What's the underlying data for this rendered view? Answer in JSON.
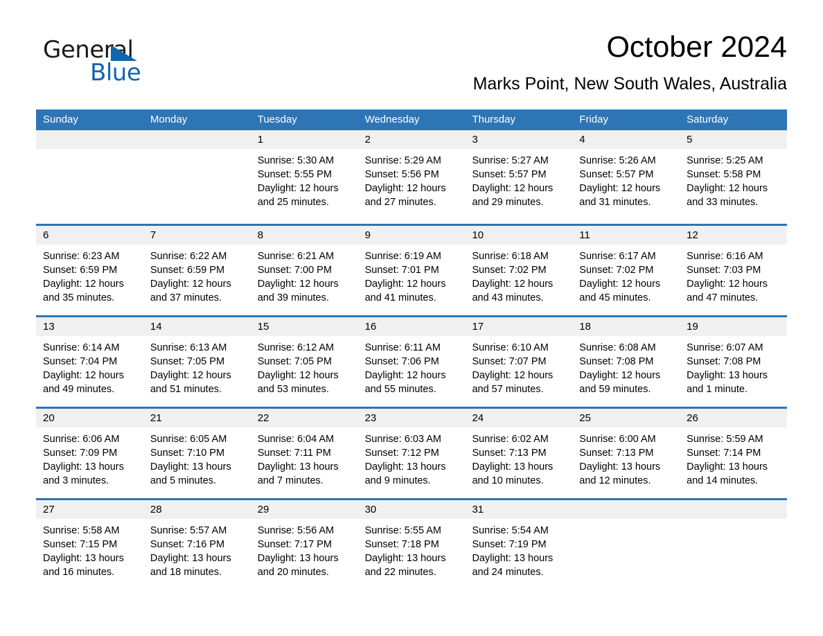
{
  "logo": {
    "word_one": "General",
    "word_two": "Blue",
    "triangle_icon": "triangle-icon",
    "brand_color": "#1266AC"
  },
  "header": {
    "title": "October 2024",
    "subtitle": "Marks Point, New South Wales, Australia"
  },
  "theme": {
    "header_blue": "#2E75B6",
    "day_band_gray": "#F0F0F0",
    "text_black": "#000000",
    "header_text": "#FFFFFF"
  },
  "weekdays": [
    "Sunday",
    "Monday",
    "Tuesday",
    "Wednesday",
    "Thursday",
    "Friday",
    "Saturday"
  ],
  "weeks": [
    [
      {
        "day": "",
        "empty": true,
        "lines": []
      },
      {
        "day": "",
        "empty": true,
        "lines": []
      },
      {
        "day": "1",
        "empty": false,
        "lines": [
          "Sunrise: 5:30 AM",
          "Sunset: 5:55 PM",
          "Daylight: 12 hours",
          "and 25 minutes."
        ]
      },
      {
        "day": "2",
        "empty": false,
        "lines": [
          "Sunrise: 5:29 AM",
          "Sunset: 5:56 PM",
          "Daylight: 12 hours",
          "and 27 minutes."
        ]
      },
      {
        "day": "3",
        "empty": false,
        "lines": [
          "Sunrise: 5:27 AM",
          "Sunset: 5:57 PM",
          "Daylight: 12 hours",
          "and 29 minutes."
        ]
      },
      {
        "day": "4",
        "empty": false,
        "lines": [
          "Sunrise: 5:26 AM",
          "Sunset: 5:57 PM",
          "Daylight: 12 hours",
          "and 31 minutes."
        ]
      },
      {
        "day": "5",
        "empty": false,
        "lines": [
          "Sunrise: 5:25 AM",
          "Sunset: 5:58 PM",
          "Daylight: 12 hours",
          "and 33 minutes."
        ]
      }
    ],
    [
      {
        "day": "6",
        "empty": false,
        "lines": [
          "Sunrise: 6:23 AM",
          "Sunset: 6:59 PM",
          "Daylight: 12 hours",
          "and 35 minutes."
        ]
      },
      {
        "day": "7",
        "empty": false,
        "lines": [
          "Sunrise: 6:22 AM",
          "Sunset: 6:59 PM",
          "Daylight: 12 hours",
          "and 37 minutes."
        ]
      },
      {
        "day": "8",
        "empty": false,
        "lines": [
          "Sunrise: 6:21 AM",
          "Sunset: 7:00 PM",
          "Daylight: 12 hours",
          "and 39 minutes."
        ]
      },
      {
        "day": "9",
        "empty": false,
        "lines": [
          "Sunrise: 6:19 AM",
          "Sunset: 7:01 PM",
          "Daylight: 12 hours",
          "and 41 minutes."
        ]
      },
      {
        "day": "10",
        "empty": false,
        "lines": [
          "Sunrise: 6:18 AM",
          "Sunset: 7:02 PM",
          "Daylight: 12 hours",
          "and 43 minutes."
        ]
      },
      {
        "day": "11",
        "empty": false,
        "lines": [
          "Sunrise: 6:17 AM",
          "Sunset: 7:02 PM",
          "Daylight: 12 hours",
          "and 45 minutes."
        ]
      },
      {
        "day": "12",
        "empty": false,
        "lines": [
          "Sunrise: 6:16 AM",
          "Sunset: 7:03 PM",
          "Daylight: 12 hours",
          "and 47 minutes."
        ]
      }
    ],
    [
      {
        "day": "13",
        "empty": false,
        "lines": [
          "Sunrise: 6:14 AM",
          "Sunset: 7:04 PM",
          "Daylight: 12 hours",
          "and 49 minutes."
        ]
      },
      {
        "day": "14",
        "empty": false,
        "lines": [
          "Sunrise: 6:13 AM",
          "Sunset: 7:05 PM",
          "Daylight: 12 hours",
          "and 51 minutes."
        ]
      },
      {
        "day": "15",
        "empty": false,
        "lines": [
          "Sunrise: 6:12 AM",
          "Sunset: 7:05 PM",
          "Daylight: 12 hours",
          "and 53 minutes."
        ]
      },
      {
        "day": "16",
        "empty": false,
        "lines": [
          "Sunrise: 6:11 AM",
          "Sunset: 7:06 PM",
          "Daylight: 12 hours",
          "and 55 minutes."
        ]
      },
      {
        "day": "17",
        "empty": false,
        "lines": [
          "Sunrise: 6:10 AM",
          "Sunset: 7:07 PM",
          "Daylight: 12 hours",
          "and 57 minutes."
        ]
      },
      {
        "day": "18",
        "empty": false,
        "lines": [
          "Sunrise: 6:08 AM",
          "Sunset: 7:08 PM",
          "Daylight: 12 hours",
          "and 59 minutes."
        ]
      },
      {
        "day": "19",
        "empty": false,
        "lines": [
          "Sunrise: 6:07 AM",
          "Sunset: 7:08 PM",
          "Daylight: 13 hours",
          "and 1 minute."
        ]
      }
    ],
    [
      {
        "day": "20",
        "empty": false,
        "lines": [
          "Sunrise: 6:06 AM",
          "Sunset: 7:09 PM",
          "Daylight: 13 hours",
          "and 3 minutes."
        ]
      },
      {
        "day": "21",
        "empty": false,
        "lines": [
          "Sunrise: 6:05 AM",
          "Sunset: 7:10 PM",
          "Daylight: 13 hours",
          "and 5 minutes."
        ]
      },
      {
        "day": "22",
        "empty": false,
        "lines": [
          "Sunrise: 6:04 AM",
          "Sunset: 7:11 PM",
          "Daylight: 13 hours",
          "and 7 minutes."
        ]
      },
      {
        "day": "23",
        "empty": false,
        "lines": [
          "Sunrise: 6:03 AM",
          "Sunset: 7:12 PM",
          "Daylight: 13 hours",
          "and 9 minutes."
        ]
      },
      {
        "day": "24",
        "empty": false,
        "lines": [
          "Sunrise: 6:02 AM",
          "Sunset: 7:13 PM",
          "Daylight: 13 hours",
          "and 10 minutes."
        ]
      },
      {
        "day": "25",
        "empty": false,
        "lines": [
          "Sunrise: 6:00 AM",
          "Sunset: 7:13 PM",
          "Daylight: 13 hours",
          "and 12 minutes."
        ]
      },
      {
        "day": "26",
        "empty": false,
        "lines": [
          "Sunrise: 5:59 AM",
          "Sunset: 7:14 PM",
          "Daylight: 13 hours",
          "and 14 minutes."
        ]
      }
    ],
    [
      {
        "day": "27",
        "empty": false,
        "lines": [
          "Sunrise: 5:58 AM",
          "Sunset: 7:15 PM",
          "Daylight: 13 hours",
          "and 16 minutes."
        ]
      },
      {
        "day": "28",
        "empty": false,
        "lines": [
          "Sunrise: 5:57 AM",
          "Sunset: 7:16 PM",
          "Daylight: 13 hours",
          "and 18 minutes."
        ]
      },
      {
        "day": "29",
        "empty": false,
        "lines": [
          "Sunrise: 5:56 AM",
          "Sunset: 7:17 PM",
          "Daylight: 13 hours",
          "and 20 minutes."
        ]
      },
      {
        "day": "30",
        "empty": false,
        "lines": [
          "Sunrise: 5:55 AM",
          "Sunset: 7:18 PM",
          "Daylight: 13 hours",
          "and 22 minutes."
        ]
      },
      {
        "day": "31",
        "empty": false,
        "lines": [
          "Sunrise: 5:54 AM",
          "Sunset: 7:19 PM",
          "Daylight: 13 hours",
          "and 24 minutes."
        ]
      },
      {
        "day": "",
        "empty": true,
        "lines": []
      },
      {
        "day": "",
        "empty": true,
        "lines": []
      }
    ]
  ]
}
